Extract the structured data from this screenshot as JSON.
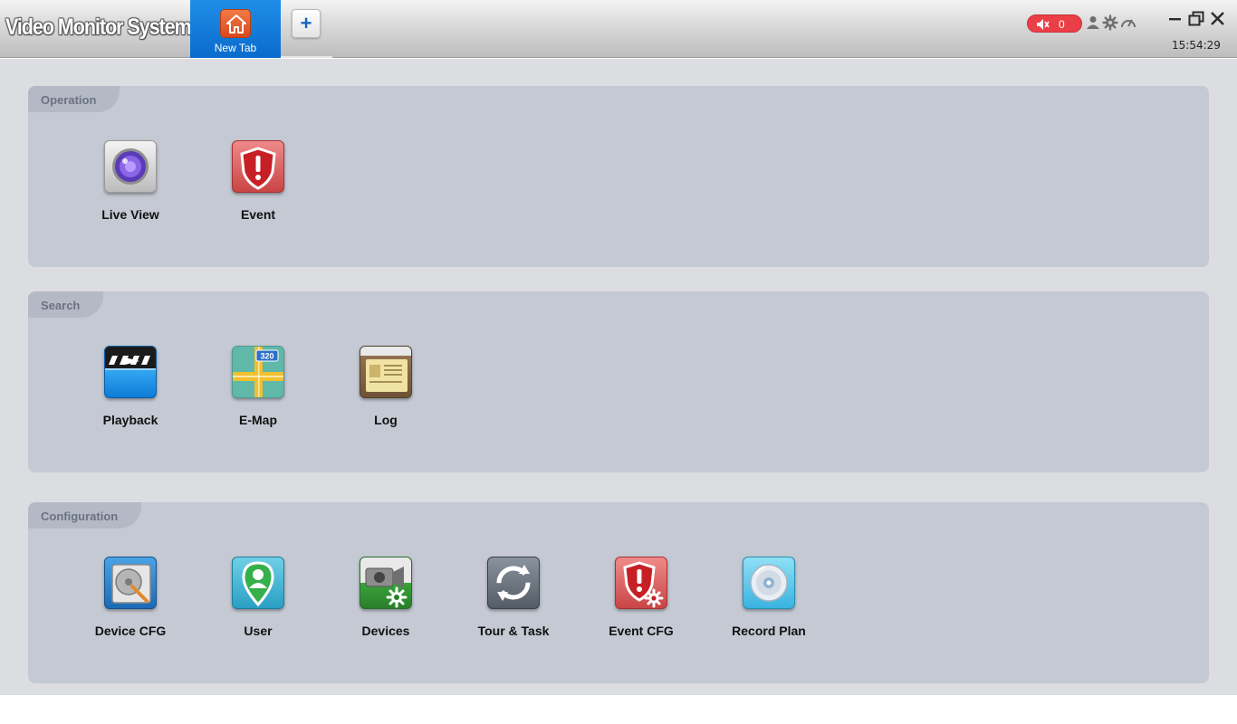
{
  "app": {
    "title": "Video Monitor System"
  },
  "tabs": [
    {
      "label": "New Tab",
      "icon": "home-icon"
    }
  ],
  "add_tab": {
    "label": "+"
  },
  "toolbar": {
    "alarm_count": "0",
    "icons": [
      "mute-icon",
      "user-icon",
      "gear-icon",
      "gauge-icon"
    ]
  },
  "window_controls": [
    "minimize-icon",
    "restore-icon",
    "close-icon"
  ],
  "clock": "15:54:29",
  "sections": [
    {
      "title": "Operation",
      "items": [
        {
          "label": "Live View",
          "icon": "camera-lens-icon"
        },
        {
          "label": "Event",
          "icon": "alert-shield-icon"
        }
      ]
    },
    {
      "title": "Search",
      "items": [
        {
          "label": "Playback",
          "icon": "clapperboard-icon"
        },
        {
          "label": "E-Map",
          "icon": "map-icon"
        },
        {
          "label": "Log",
          "icon": "log-book-icon"
        }
      ]
    },
    {
      "title": "Configuration",
      "items": [
        {
          "label": "Device CFG",
          "icon": "device-config-icon"
        },
        {
          "label": "User",
          "icon": "user-pin-icon"
        },
        {
          "label": "Devices",
          "icon": "camera-gear-icon"
        },
        {
          "label": "Tour & Task",
          "icon": "refresh-cycle-icon"
        },
        {
          "label": "Event CFG",
          "icon": "alert-shield-gear-icon"
        },
        {
          "label": "Record Plan",
          "icon": "disc-icon"
        }
      ]
    }
  ],
  "colors": {
    "tab_active": "#0a6bcc",
    "panel_bg": "#c4c9d3",
    "panel_tab_bg": "#b4b9c5",
    "alarm": "#ea3f47",
    "main_bg": "#dcdde1"
  }
}
